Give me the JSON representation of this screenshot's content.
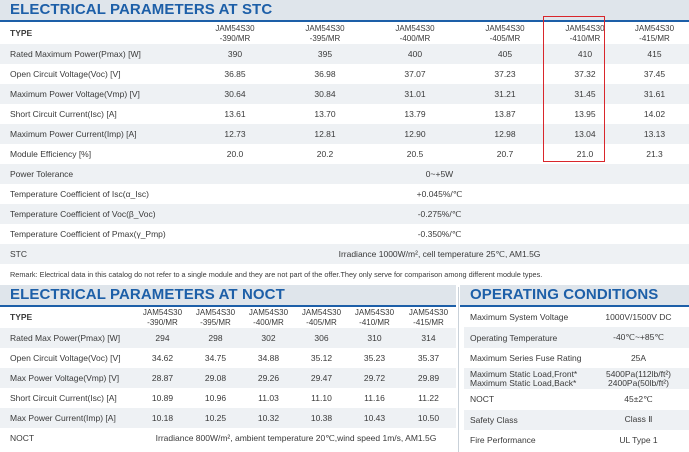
{
  "stc": {
    "title": "ELECTRICAL PARAMETERS AT STC",
    "type_label": "TYPE",
    "models": [
      [
        "JAM54S30",
        "-390/MR"
      ],
      [
        "JAM54S30",
        "-395/MR"
      ],
      [
        "JAM54S30",
        "-400/MR"
      ],
      [
        "JAM54S30",
        "-405/MR"
      ],
      [
        "JAM54S30",
        "-410/MR"
      ],
      [
        "JAM54S30",
        "-415/MR"
      ]
    ],
    "rows": [
      {
        "label": "Rated Maximum Power(Pmax) [W]",
        "values": [
          "390",
          "395",
          "400",
          "405",
          "410",
          "415"
        ]
      },
      {
        "label": "Open Circuit Voltage(Voc) [V]",
        "values": [
          "36.85",
          "36.98",
          "37.07",
          "37.23",
          "37.32",
          "37.45"
        ]
      },
      {
        "label": "Maximum Power Voltage(Vmp) [V]",
        "values": [
          "30.64",
          "30.84",
          "31.01",
          "31.21",
          "31.45",
          "31.61"
        ]
      },
      {
        "label": "Short Circuit Current(Isc) [A]",
        "values": [
          "13.61",
          "13.70",
          "13.79",
          "13.87",
          "13.95",
          "14.02"
        ]
      },
      {
        "label": "Maximum Power Current(Imp) [A]",
        "values": [
          "12.73",
          "12.81",
          "12.90",
          "12.98",
          "13.04",
          "13.13"
        ]
      },
      {
        "label": "Module Efficiency [%]",
        "values": [
          "20.0",
          "20.2",
          "20.5",
          "20.7",
          "21.0",
          "21.3"
        ]
      }
    ],
    "span_rows": [
      {
        "label": "Power Tolerance",
        "value": "0~+5W"
      },
      {
        "label": "Temperature Coefficient of Isc(α_Isc)",
        "value": "+0.045%/℃"
      },
      {
        "label": "Temperature Coefficient of Voc(β_Voc)",
        "value": "-0.275%/℃"
      },
      {
        "label": "Temperature Coefficient of Pmax(γ_Pmp)",
        "value": "-0.350%/℃"
      },
      {
        "label": "STC",
        "value": "Irradiance 1000W/m², cell temperature 25℃, AM1.5G"
      }
    ],
    "remark": "Remark: Electrical data in this catalog do not refer to a single module and they are not part of the offer.They only serve for comparison among different module types."
  },
  "noct": {
    "title": "ELECTRICAL PARAMETERS AT NOCT",
    "type_label": "TYPE",
    "models": [
      [
        "JAM54S30",
        "-390/MR"
      ],
      [
        "JAM54S30",
        "-395/MR"
      ],
      [
        "JAM54S30",
        "-400/MR"
      ],
      [
        "JAM54S30",
        "-405/MR"
      ],
      [
        "JAM54S30",
        "-410/MR"
      ],
      [
        "JAM54S30",
        "-415/MR"
      ]
    ],
    "rows": [
      {
        "label": "Rated Max Power(Pmax) [W]",
        "values": [
          "294",
          "298",
          "302",
          "306",
          "310",
          "314"
        ]
      },
      {
        "label": "Open Circuit Voltage(Voc) [V]",
        "values": [
          "34.62",
          "34.75",
          "34.88",
          "35.12",
          "35.23",
          "35.37"
        ]
      },
      {
        "label": "Max Power Voltage(Vmp) [V]",
        "values": [
          "28.87",
          "29.08",
          "29.26",
          "29.47",
          "29.72",
          "29.89"
        ]
      },
      {
        "label": "Short Circuit Current(Isc) [A]",
        "values": [
          "10.89",
          "10.96",
          "11.03",
          "11.10",
          "11.16",
          "11.22"
        ]
      },
      {
        "label": "Max Power Current(Imp) [A]",
        "values": [
          "10.18",
          "10.25",
          "10.32",
          "10.38",
          "10.43",
          "10.50"
        ]
      }
    ],
    "noct_label": "NOCT",
    "noct_value": "Irradiance 800W/m², ambient temperature 20℃,wind speed 1m/s, AM1.5G"
  },
  "operating": {
    "title": "OPERATING CONDITIONS",
    "rows": [
      {
        "label": "Maximum System Voltage",
        "value": "1000V/1500V DC"
      },
      {
        "label": "Operating Temperature",
        "value": "-40℃~+85℃"
      },
      {
        "label": "Maximum Series Fuse Rating",
        "value": "25A"
      },
      {
        "label": "NOCT",
        "value": "45±2℃"
      },
      {
        "label": "Safety Class",
        "value": "Class Ⅱ"
      },
      {
        "label": "Fire Performance",
        "value": "UL Type 1"
      }
    ],
    "load": {
      "label_front": "Maximum Static Load,Front*",
      "label_back": "Maximum Static Load,Back*",
      "value_front": "5400Pa(112lb/ft²)",
      "value_back": "2400Pa(50lb/ft²)"
    }
  },
  "colors": {
    "title_text": "#1d5fa8",
    "title_bg": "#dfe5eb",
    "row_alt": "#eef1f4",
    "highlight_border": "#d9262b"
  }
}
